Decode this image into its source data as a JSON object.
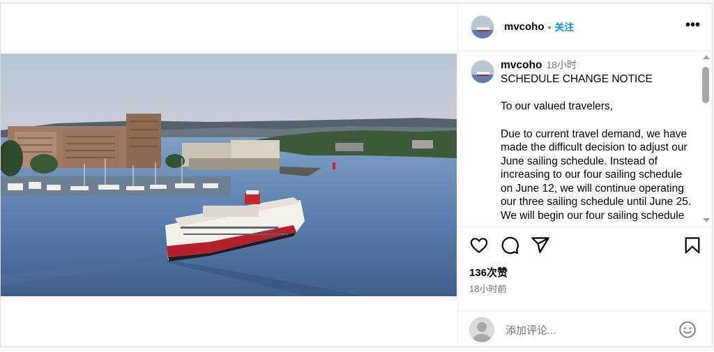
{
  "post": {
    "username": "mvcoho",
    "separator": "•",
    "follow_label": "关注",
    "more_label": "•••",
    "caption": {
      "username": "mvcoho",
      "time": "18小时",
      "title": "SCHEDULE CHANGE NOTICE",
      "greeting": "To our valued travelers,",
      "body": "Due to current travel demand, we have made the difficult decision to adjust our June sailing schedule. Instead of increasing to our four sailing schedule on June 12, we will continue operating our three sailing schedule until June 25. We will begin our four sailing schedule on..."
    },
    "likes": "136次赞",
    "posted_ago": "18小时前",
    "comment_placeholder": "添加评论...",
    "icons": [
      "heart-icon",
      "comment-icon",
      "share-icon",
      "bookmark-icon",
      "emoji-icon",
      "more-icon"
    ]
  }
}
